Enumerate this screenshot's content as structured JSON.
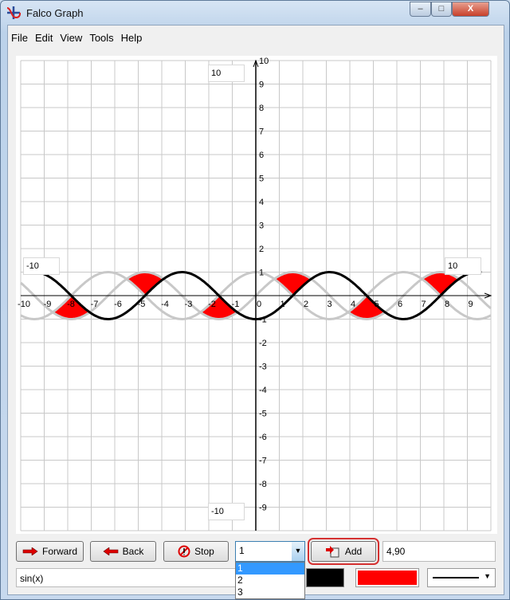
{
  "window": {
    "title": "Falco Graph",
    "minimize": "‒",
    "maximize": "□",
    "close": "X"
  },
  "menu": [
    "File",
    "Edit",
    "View",
    "Tools",
    "Help"
  ],
  "graph": {
    "xlim": [
      -10,
      10
    ],
    "ylim": [
      -10,
      10
    ],
    "grid": true,
    "x_ticks": [
      -10,
      -9,
      -8,
      -7,
      -6,
      -5,
      -4,
      -3,
      -2,
      -1,
      0,
      1,
      2,
      3,
      4,
      5,
      6,
      7,
      8,
      9
    ],
    "y_ticks": [
      10,
      9,
      8,
      7,
      6,
      5,
      4,
      3,
      2,
      1,
      -1,
      -2,
      -3,
      -4,
      -5,
      -6,
      -7,
      -8,
      -9
    ],
    "range_boxes": {
      "y_max": "10",
      "y_min": "-10",
      "x_min": "-10",
      "x_max": "10"
    },
    "colors": {
      "curve": "#000000",
      "ghost_curves": "#c8c8c8",
      "fill": "#ff0000",
      "grid": "#c8c8c8"
    }
  },
  "controls": {
    "forward": "Forward",
    "back": "Back",
    "stop": "Stop",
    "combo_value": "1",
    "combo_options": [
      "1",
      "2",
      "3"
    ],
    "combo_selected": "1",
    "add": "Add",
    "value_field": "4,90",
    "function_field": "sin(x)",
    "line_color": "#000000",
    "fill_color": "#ff0000"
  }
}
